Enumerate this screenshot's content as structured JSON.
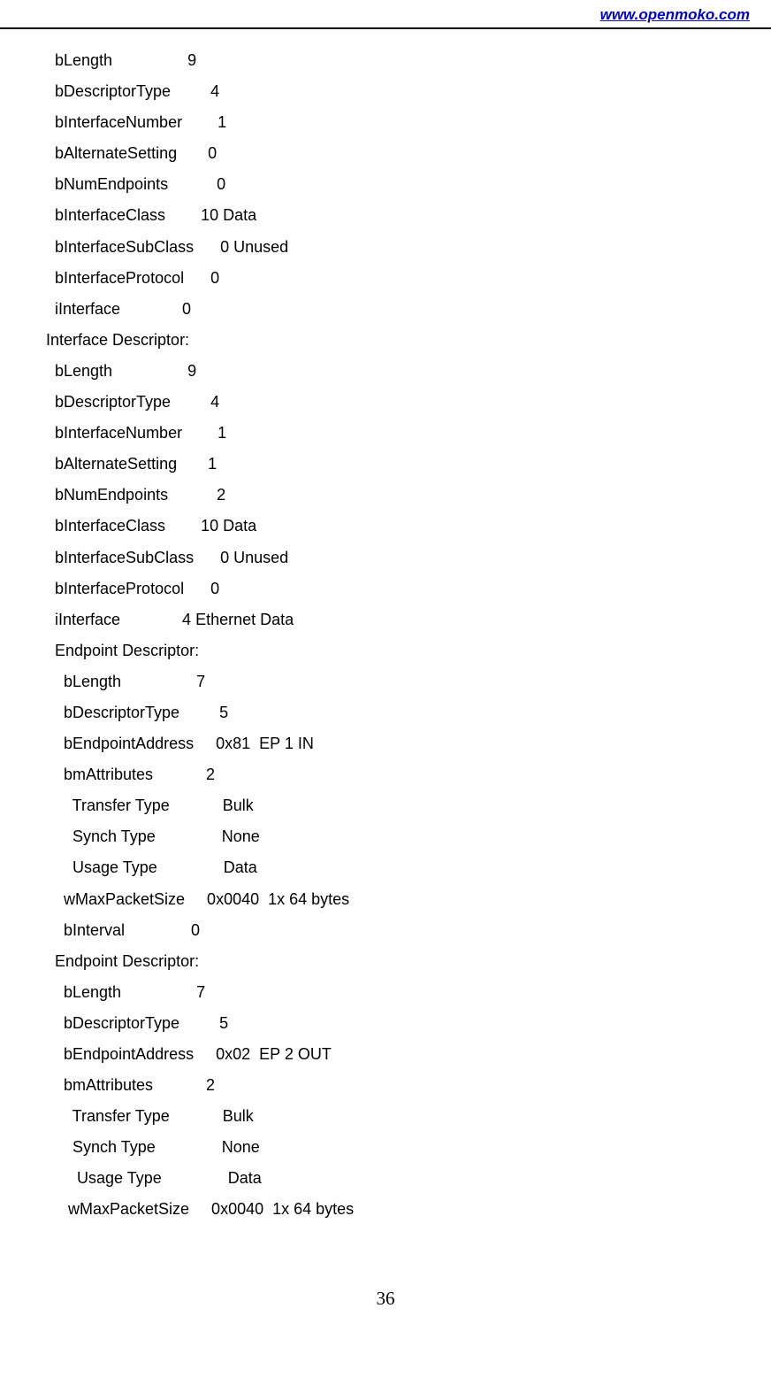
{
  "header": {
    "url": "www.openmoko.com"
  },
  "lines": [
    "  bLength                 9",
    "  bDescriptorType         4",
    "  bInterfaceNumber        1",
    "  bAlternateSetting       0",
    "  bNumEndpoints           0",
    "  bInterfaceClass        10 Data",
    "  bInterfaceSubClass      0 Unused",
    "  bInterfaceProtocol      0",
    "  iInterface              0",
    "Interface Descriptor:",
    "  bLength                 9",
    "  bDescriptorType         4",
    "  bInterfaceNumber        1",
    "  bAlternateSetting       1",
    "  bNumEndpoints           2",
    "  bInterfaceClass        10 Data",
    "  bInterfaceSubClass      0 Unused",
    "  bInterfaceProtocol      0",
    "  iInterface              4 Ethernet Data",
    "  Endpoint Descriptor:",
    "    bLength                 7",
    "    bDescriptorType         5",
    "    bEndpointAddress     0x81  EP 1 IN",
    "    bmAttributes            2",
    "      Transfer Type            Bulk",
    "      Synch Type               None",
    "      Usage Type               Data",
    "    wMaxPacketSize     0x0040  1x 64 bytes",
    "    bInterval               0",
    "  Endpoint Descriptor:",
    "    bLength                 7",
    "    bDescriptorType         5",
    "    bEndpointAddress     0x02  EP 2 OUT",
    "    bmAttributes            2",
    "      Transfer Type            Bulk",
    "      Synch Type               None",
    "       Usage Type               Data",
    "     wMaxPacketSize     0x0040  1x 64 bytes"
  ],
  "page_number": "36"
}
